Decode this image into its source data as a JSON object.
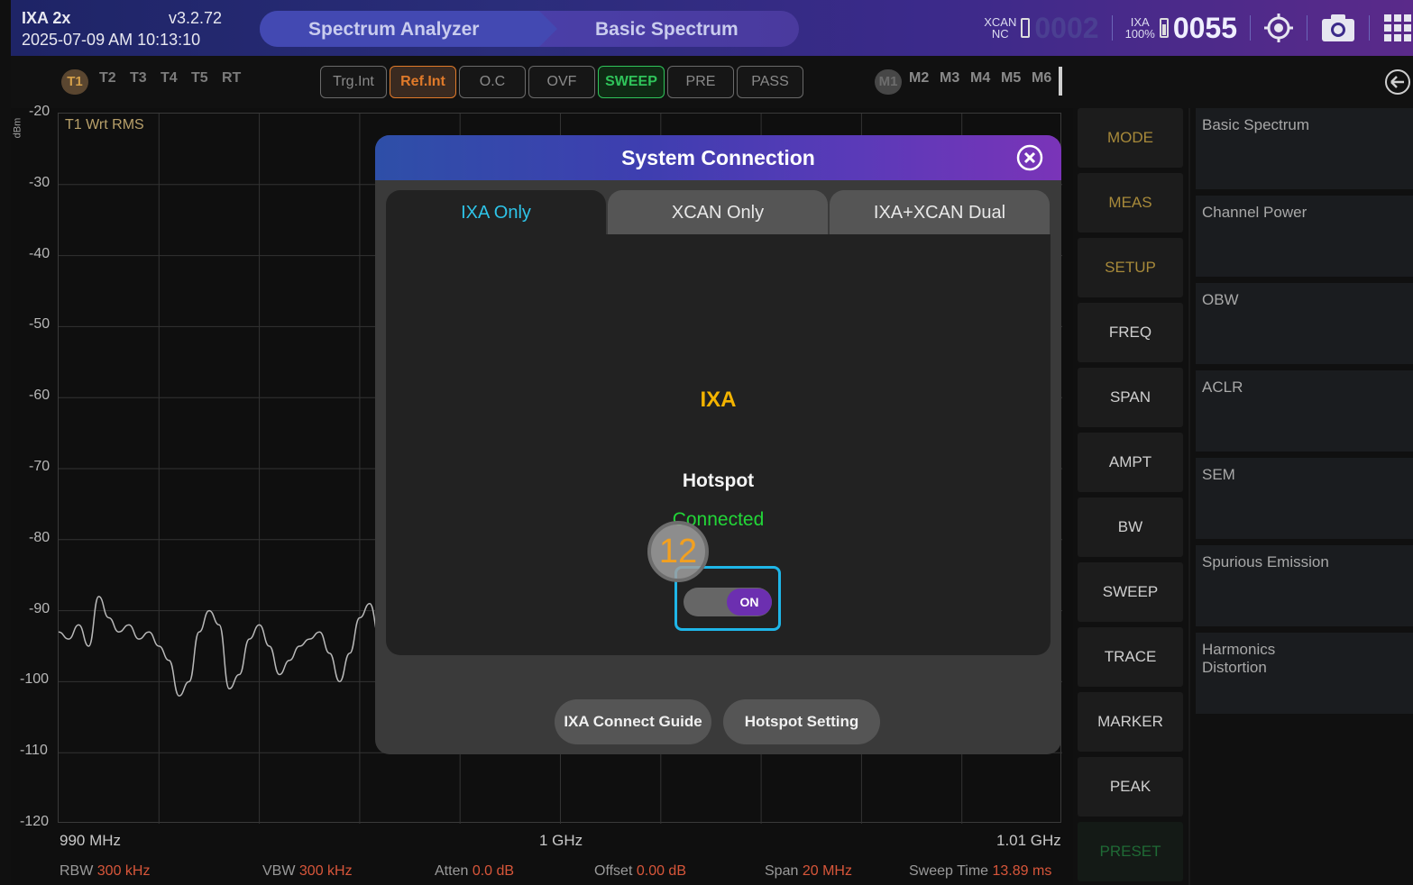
{
  "header": {
    "device": "IXA 2x",
    "version": "v3.2.72",
    "datetime": "2025-07-09 AM 10:13:10",
    "mode": "Spectrum Analyzer",
    "measurement": "Basic Spectrum",
    "xcan_label": "XCAN",
    "xcan_status": "NC",
    "xcan_count": "0002",
    "ixa_label": "IXA",
    "ixa_battery": "100%",
    "ixa_count": "0055"
  },
  "traces": [
    "T1",
    "T2",
    "T3",
    "T4",
    "T5",
    "RT"
  ],
  "status_buttons": [
    "Trg.Int",
    "Ref.Int",
    "O.C",
    "OVF",
    "SWEEP",
    "PRE",
    "PASS"
  ],
  "markers": [
    "M1",
    "M2",
    "M3",
    "M4",
    "M5",
    "M6"
  ],
  "chart": {
    "unit": "dBm",
    "trace_label": "T1 Wrt RMS",
    "x_start": "990 MHz",
    "x_center": "1 GHz",
    "x_stop": "1.01 GHz"
  },
  "chart_data": {
    "type": "line",
    "title": "",
    "xlabel": "",
    "ylabel": "dBm",
    "ylim": [
      -120,
      -20
    ],
    "yticks": [
      -20,
      -30,
      -40,
      -50,
      -60,
      -70,
      -80,
      -90,
      -100,
      -110,
      -120
    ],
    "xlim": [
      990,
      1010
    ],
    "x_unit": "MHz",
    "xticks_labels": [
      "990 MHz",
      "1 GHz",
      "1.01 GHz"
    ],
    "series": [
      {
        "x": [
          990.0,
          990.2,
          990.4,
          990.6,
          990.8,
          991.0,
          991.2,
          991.4,
          991.6,
          991.8,
          992.0,
          992.2,
          992.4,
          992.6,
          992.8,
          993.0,
          993.2,
          993.4,
          993.6,
          993.8,
          994.0,
          994.2,
          994.4,
          994.6,
          994.8,
          995.0,
          995.2,
          995.4,
          995.6,
          995.8,
          996.0,
          996.2,
          996.4,
          996.6
        ],
        "y": [
          -93,
          -94,
          -92,
          -95,
          -88,
          -91,
          -93,
          -92,
          -94,
          -93,
          -95,
          -97,
          -102,
          -100,
          -93,
          -90,
          -92,
          -101,
          -99,
          -94,
          -92,
          -95,
          -99,
          -97,
          -95,
          -94,
          -93,
          -96,
          -100,
          -96,
          -91,
          -89,
          -94,
          -97
        ]
      }
    ],
    "grid": true
  },
  "bottom_stats": {
    "rbw_label": "RBW",
    "rbw_value": "300 kHz",
    "vbw_label": "VBW",
    "vbw_value": "300 kHz",
    "atten_label": "Atten",
    "atten_value": "0.0 dB",
    "offset_label": "Offset",
    "offset_value": "0.00 dB",
    "span_label": "Span",
    "span_value": "20 MHz",
    "sweep_label": "Sweep Time",
    "sweep_value": "13.89 ms"
  },
  "menu": [
    "MODE",
    "MEAS",
    "SETUP",
    "FREQ",
    "SPAN",
    "AMPT",
    "BW",
    "SWEEP",
    "TRACE",
    "MARKER",
    "PEAK",
    "PRESET"
  ],
  "submenu": [
    "Basic Spectrum",
    "Channel Power",
    "OBW",
    "ACLR",
    "SEM",
    "Spurious Emission",
    "Harmonics\nDistortion"
  ],
  "dialog": {
    "title": "System Connection",
    "tabs": [
      "IXA Only",
      "XCAN Only",
      "IXA+XCAN Dual"
    ],
    "device": "IXA",
    "connection_type": "Hotspot",
    "status": "Connected",
    "toggle_label": "ON",
    "step_number": "12",
    "guide_button": "IXA Connect Guide",
    "hotspot_button": "Hotspot Setting"
  },
  "colors": {
    "accent_cyan": "#1fb6e8",
    "status_green": "#22d638",
    "device_amber": "#f4b400",
    "toggle_purple": "#6c2fb0",
    "stat_value": "#d8563a"
  },
  "icons": [
    "close-icon",
    "target-icon",
    "camera-icon",
    "grid-icon",
    "back-icon",
    "battery-icon"
  ]
}
